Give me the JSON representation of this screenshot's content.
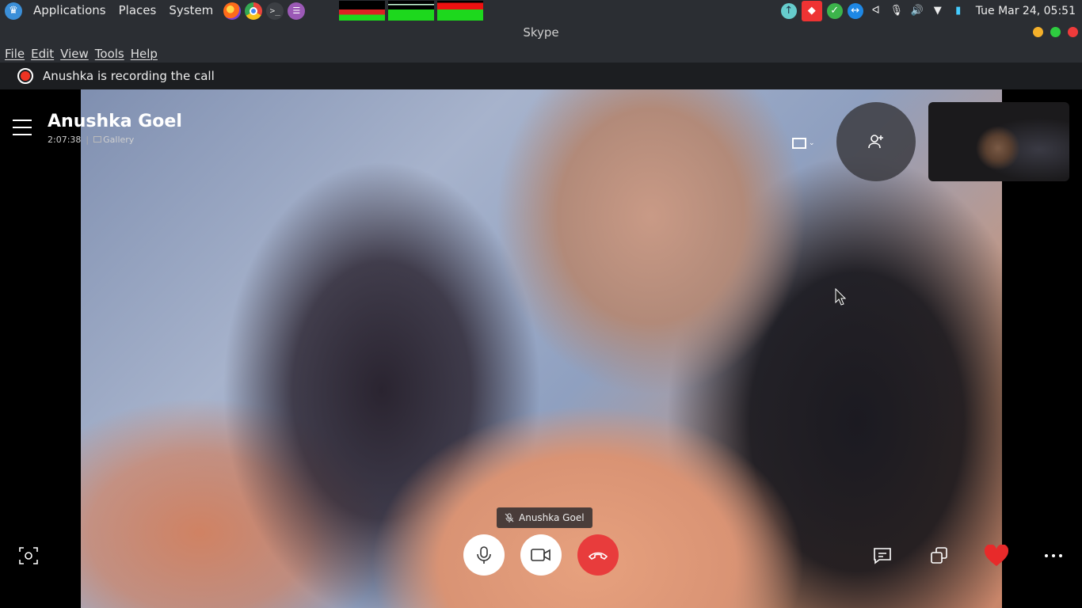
{
  "panel": {
    "menu": [
      "Applications",
      "Places",
      "System"
    ],
    "launchers": [
      "firefox-icon",
      "chrome-icon",
      "terminal-icon",
      "notes-icon"
    ],
    "clock": "Tue Mar 24, 05:51"
  },
  "window": {
    "title": "Skype"
  },
  "menubar": {
    "items": [
      "File",
      "Edit",
      "View",
      "Tools",
      "Help"
    ]
  },
  "recording": {
    "text": "Anushka is recording the call"
  },
  "call": {
    "name": "Anushka Goel",
    "duration": "2:07:38",
    "view_mode": "Gallery",
    "participant_label": "Anushka Goel"
  },
  "colors": {
    "end_call": "#e83c3c",
    "heart": "#e82a2a",
    "record": "#e32"
  }
}
